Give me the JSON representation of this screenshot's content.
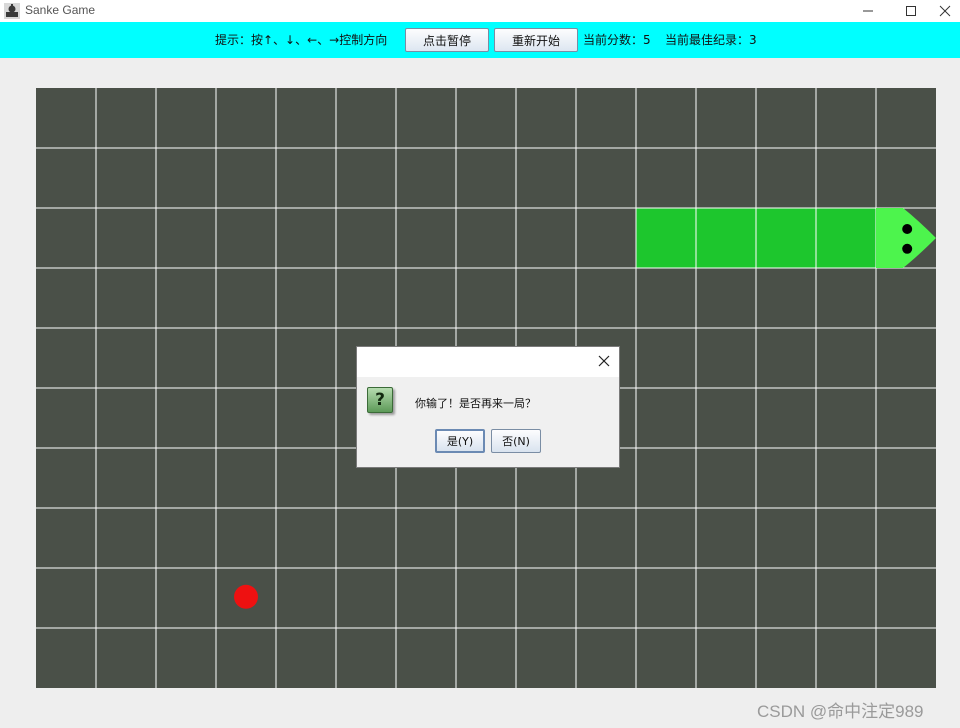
{
  "window": {
    "title": "Sanke Game"
  },
  "toolbar": {
    "hint": "提示：按↑、↓、←、→控制方向",
    "pause_label": "点击暂停",
    "restart_label": "重新开始",
    "score_text": "当前分数：5",
    "best_text": "当前最佳纪录：3"
  },
  "board": {
    "columns": 15,
    "rows": 10,
    "background_color": "#4a5048",
    "grid_color": "#ffffff",
    "snake": {
      "head": {
        "col": 14,
        "row": 2,
        "direction": "right",
        "color": "#4df44d"
      },
      "body": [
        {
          "col": 13,
          "row": 2
        },
        {
          "col": 12,
          "row": 2
        },
        {
          "col": 11,
          "row": 2
        },
        {
          "col": 10,
          "row": 2
        }
      ],
      "body_color": "#1dc62d"
    },
    "food": {
      "col": 3,
      "row": 8,
      "color": "#ee1111"
    }
  },
  "dialog": {
    "message": "你输了！是否再来一局？",
    "icon": "question-icon",
    "icon_glyph": "?",
    "yes_label": "是(Y)",
    "no_label": "否(N)"
  },
  "watermark": "CSDN @命中注定989"
}
